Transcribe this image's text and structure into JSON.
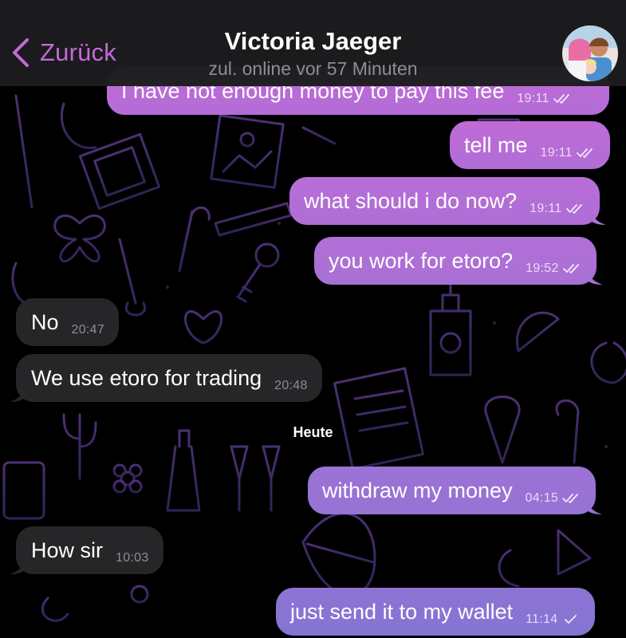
{
  "header": {
    "back_label": "Zurück",
    "contact_name": "Victoria Jaeger",
    "status": "zul. online vor 57 Minuten"
  },
  "colors": {
    "accent": "#c26ad8",
    "outgoing_top": "#c874d8",
    "outgoing_bottom": "#8a6fd0",
    "incoming": "#262628",
    "wallpaper_line": "#6a3f9a"
  },
  "messages": [
    {
      "direction": "out",
      "text": "I have not enough money to pay this fee",
      "time": "19:11",
      "status": "read"
    },
    {
      "direction": "out",
      "text": "tell me",
      "time": "19:11",
      "status": "read"
    },
    {
      "direction": "out",
      "text": "what should i do now?",
      "time": "19:11",
      "status": "read"
    },
    {
      "direction": "out",
      "text": "you work for etoro?",
      "time": "19:52",
      "status": "read"
    },
    {
      "direction": "in",
      "text": "No",
      "time": "20:47"
    },
    {
      "direction": "in",
      "text": "We use etoro for trading",
      "time": "20:48"
    },
    {
      "direction": "out",
      "text": "withdraw my money",
      "time": "04:15",
      "status": "read"
    },
    {
      "direction": "in",
      "text": "How sir",
      "time": "10:03"
    },
    {
      "direction": "out",
      "text": "just send it to my wallet",
      "time": "11:14",
      "status": "delivered"
    }
  ],
  "date_separator": "Heute"
}
